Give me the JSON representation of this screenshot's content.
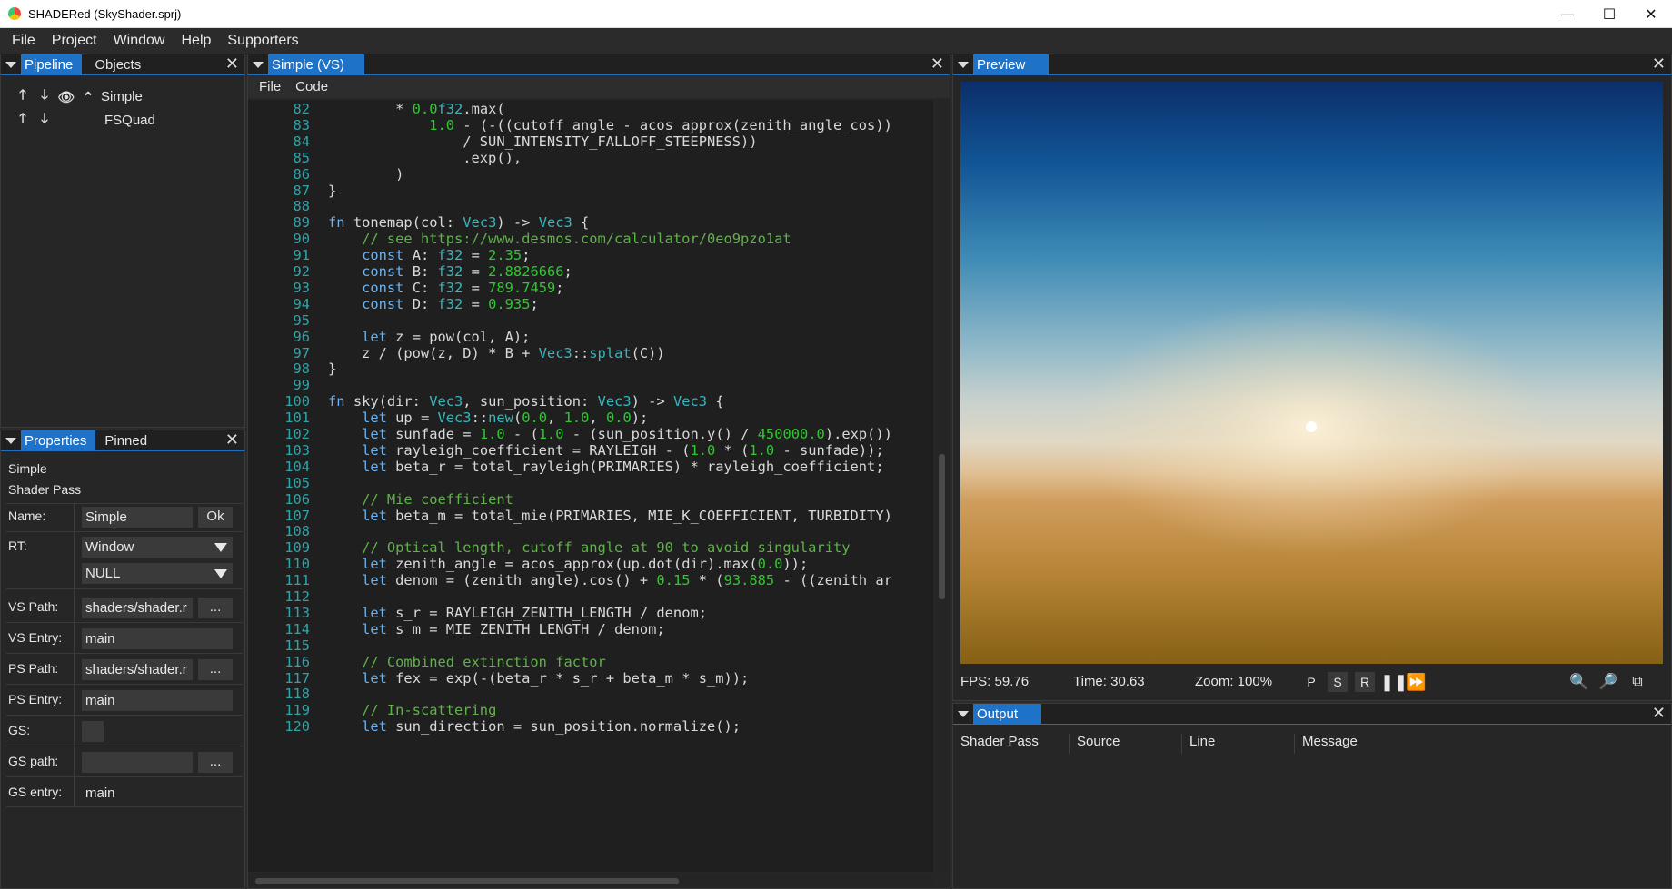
{
  "window": {
    "title": "SHADERed (SkyShader.sprj)",
    "controls": [
      "—",
      "☐",
      "✕"
    ]
  },
  "menu": [
    "File",
    "Project",
    "Window",
    "Help",
    "Supporters"
  ],
  "pipeline_panel": {
    "tabs": [
      "Pipeline",
      "Objects"
    ],
    "items": [
      {
        "label": "Simple"
      },
      {
        "label": "FSQuad"
      }
    ]
  },
  "properties_panel": {
    "tabs": [
      "Properties",
      "Pinned"
    ],
    "item_name": "Simple",
    "item_type": "Shader Pass",
    "rows": {
      "name_label": "Name:",
      "name_value": "Simple",
      "ok_button": "Ok",
      "rt_label": "RT:",
      "rt_value1": "Window",
      "rt_value2": "NULL",
      "vs_path_label": "VS Path:",
      "vs_path_value": "shaders/shader.r",
      "browse": "...",
      "vs_entry_label": "VS Entry:",
      "vs_entry_value": "main",
      "ps_path_label": "PS Path:",
      "ps_path_value": "shaders/shader.r",
      "ps_entry_label": "PS Entry:",
      "ps_entry_value": "main",
      "gs_label": "GS:",
      "gs_path_label": "GS path:",
      "gs_path_value": "",
      "gs_entry_label": "GS entry:",
      "gs_entry_value": "main"
    }
  },
  "editor": {
    "tab": "Simple (VS)",
    "menu": [
      "File",
      "Code"
    ],
    "lines": [
      {
        "n": "82",
        "t": "        * 0.0f32.max("
      },
      {
        "n": "83",
        "t": "            1.0 - (-((cutoff_angle - acos_approx(zenith_angle_cos))"
      },
      {
        "n": "84",
        "t": "                / SUN_INTENSITY_FALLOFF_STEEPNESS))"
      },
      {
        "n": "85",
        "t": "                .exp(),"
      },
      {
        "n": "86",
        "t": "        )"
      },
      {
        "n": "87",
        "t": "}"
      },
      {
        "n": "88",
        "t": ""
      },
      {
        "n": "89",
        "t": "fn tonemap(col: Vec3) -> Vec3 {"
      },
      {
        "n": "90",
        "t": "    // see https://www.desmos.com/calculator/0eo9pzo1at"
      },
      {
        "n": "91",
        "t": "    const A: f32 = 2.35;"
      },
      {
        "n": "92",
        "t": "    const B: f32 = 2.8826666;"
      },
      {
        "n": "93",
        "t": "    const C: f32 = 789.7459;"
      },
      {
        "n": "94",
        "t": "    const D: f32 = 0.935;"
      },
      {
        "n": "95",
        "t": ""
      },
      {
        "n": "96",
        "t": "    let z = pow(col, A);"
      },
      {
        "n": "97",
        "t": "    z / (pow(z, D) * B + Vec3::splat(C))"
      },
      {
        "n": "98",
        "t": "}"
      },
      {
        "n": "99",
        "t": ""
      },
      {
        "n": "100",
        "t": "fn sky(dir: Vec3, sun_position: Vec3) -> Vec3 {"
      },
      {
        "n": "101",
        "t": "    let up = Vec3::new(0.0, 1.0, 0.0);"
      },
      {
        "n": "102",
        "t": "    let sunfade = 1.0 - (1.0 - (sun_position.y() / 450000.0).exp())"
      },
      {
        "n": "103",
        "t": "    let rayleigh_coefficient = RAYLEIGH - (1.0 * (1.0 - sunfade));"
      },
      {
        "n": "104",
        "t": "    let beta_r = total_rayleigh(PRIMARIES) * rayleigh_coefficient;"
      },
      {
        "n": "105",
        "t": ""
      },
      {
        "n": "106",
        "t": "    // Mie coefficient"
      },
      {
        "n": "107",
        "t": "    let beta_m = total_mie(PRIMARIES, MIE_K_COEFFICIENT, TURBIDITY)"
      },
      {
        "n": "108",
        "t": ""
      },
      {
        "n": "109",
        "t": "    // Optical length, cutoff angle at 90 to avoid singularity"
      },
      {
        "n": "110",
        "t": "    let zenith_angle = acos_approx(up.dot(dir).max(0.0));"
      },
      {
        "n": "111",
        "t": "    let denom = (zenith_angle).cos() + 0.15 * (93.885 - ((zenith_ar"
      },
      {
        "n": "112",
        "t": ""
      },
      {
        "n": "113",
        "t": "    let s_r = RAYLEIGH_ZENITH_LENGTH / denom;"
      },
      {
        "n": "114",
        "t": "    let s_m = MIE_ZENITH_LENGTH / denom;"
      },
      {
        "n": "115",
        "t": ""
      },
      {
        "n": "116",
        "t": "    // Combined extinction factor"
      },
      {
        "n": "117",
        "t": "    let fex = exp(-(beta_r * s_r + beta_m * s_m));"
      },
      {
        "n": "118",
        "t": ""
      },
      {
        "n": "119",
        "t": "    // In-scattering"
      },
      {
        "n": "120",
        "t": "    let sun_direction = sun_position.normalize();"
      }
    ]
  },
  "preview": {
    "tab": "Preview",
    "fps": "FPS: 59.76",
    "time": "Time: 30.63",
    "zoom": "Zoom: 100%",
    "buttons": [
      "P",
      "S",
      "R"
    ]
  },
  "output": {
    "tab": "Output",
    "columns": [
      "Shader Pass",
      "Source",
      "Line",
      "Message"
    ]
  },
  "colors": {
    "accent": "#1e73c8",
    "keyword": "#6cb2f0",
    "type": "#37b7bd",
    "number": "#2ec92e",
    "comment": "#61b24c",
    "line_number": "#2fa4a8"
  }
}
